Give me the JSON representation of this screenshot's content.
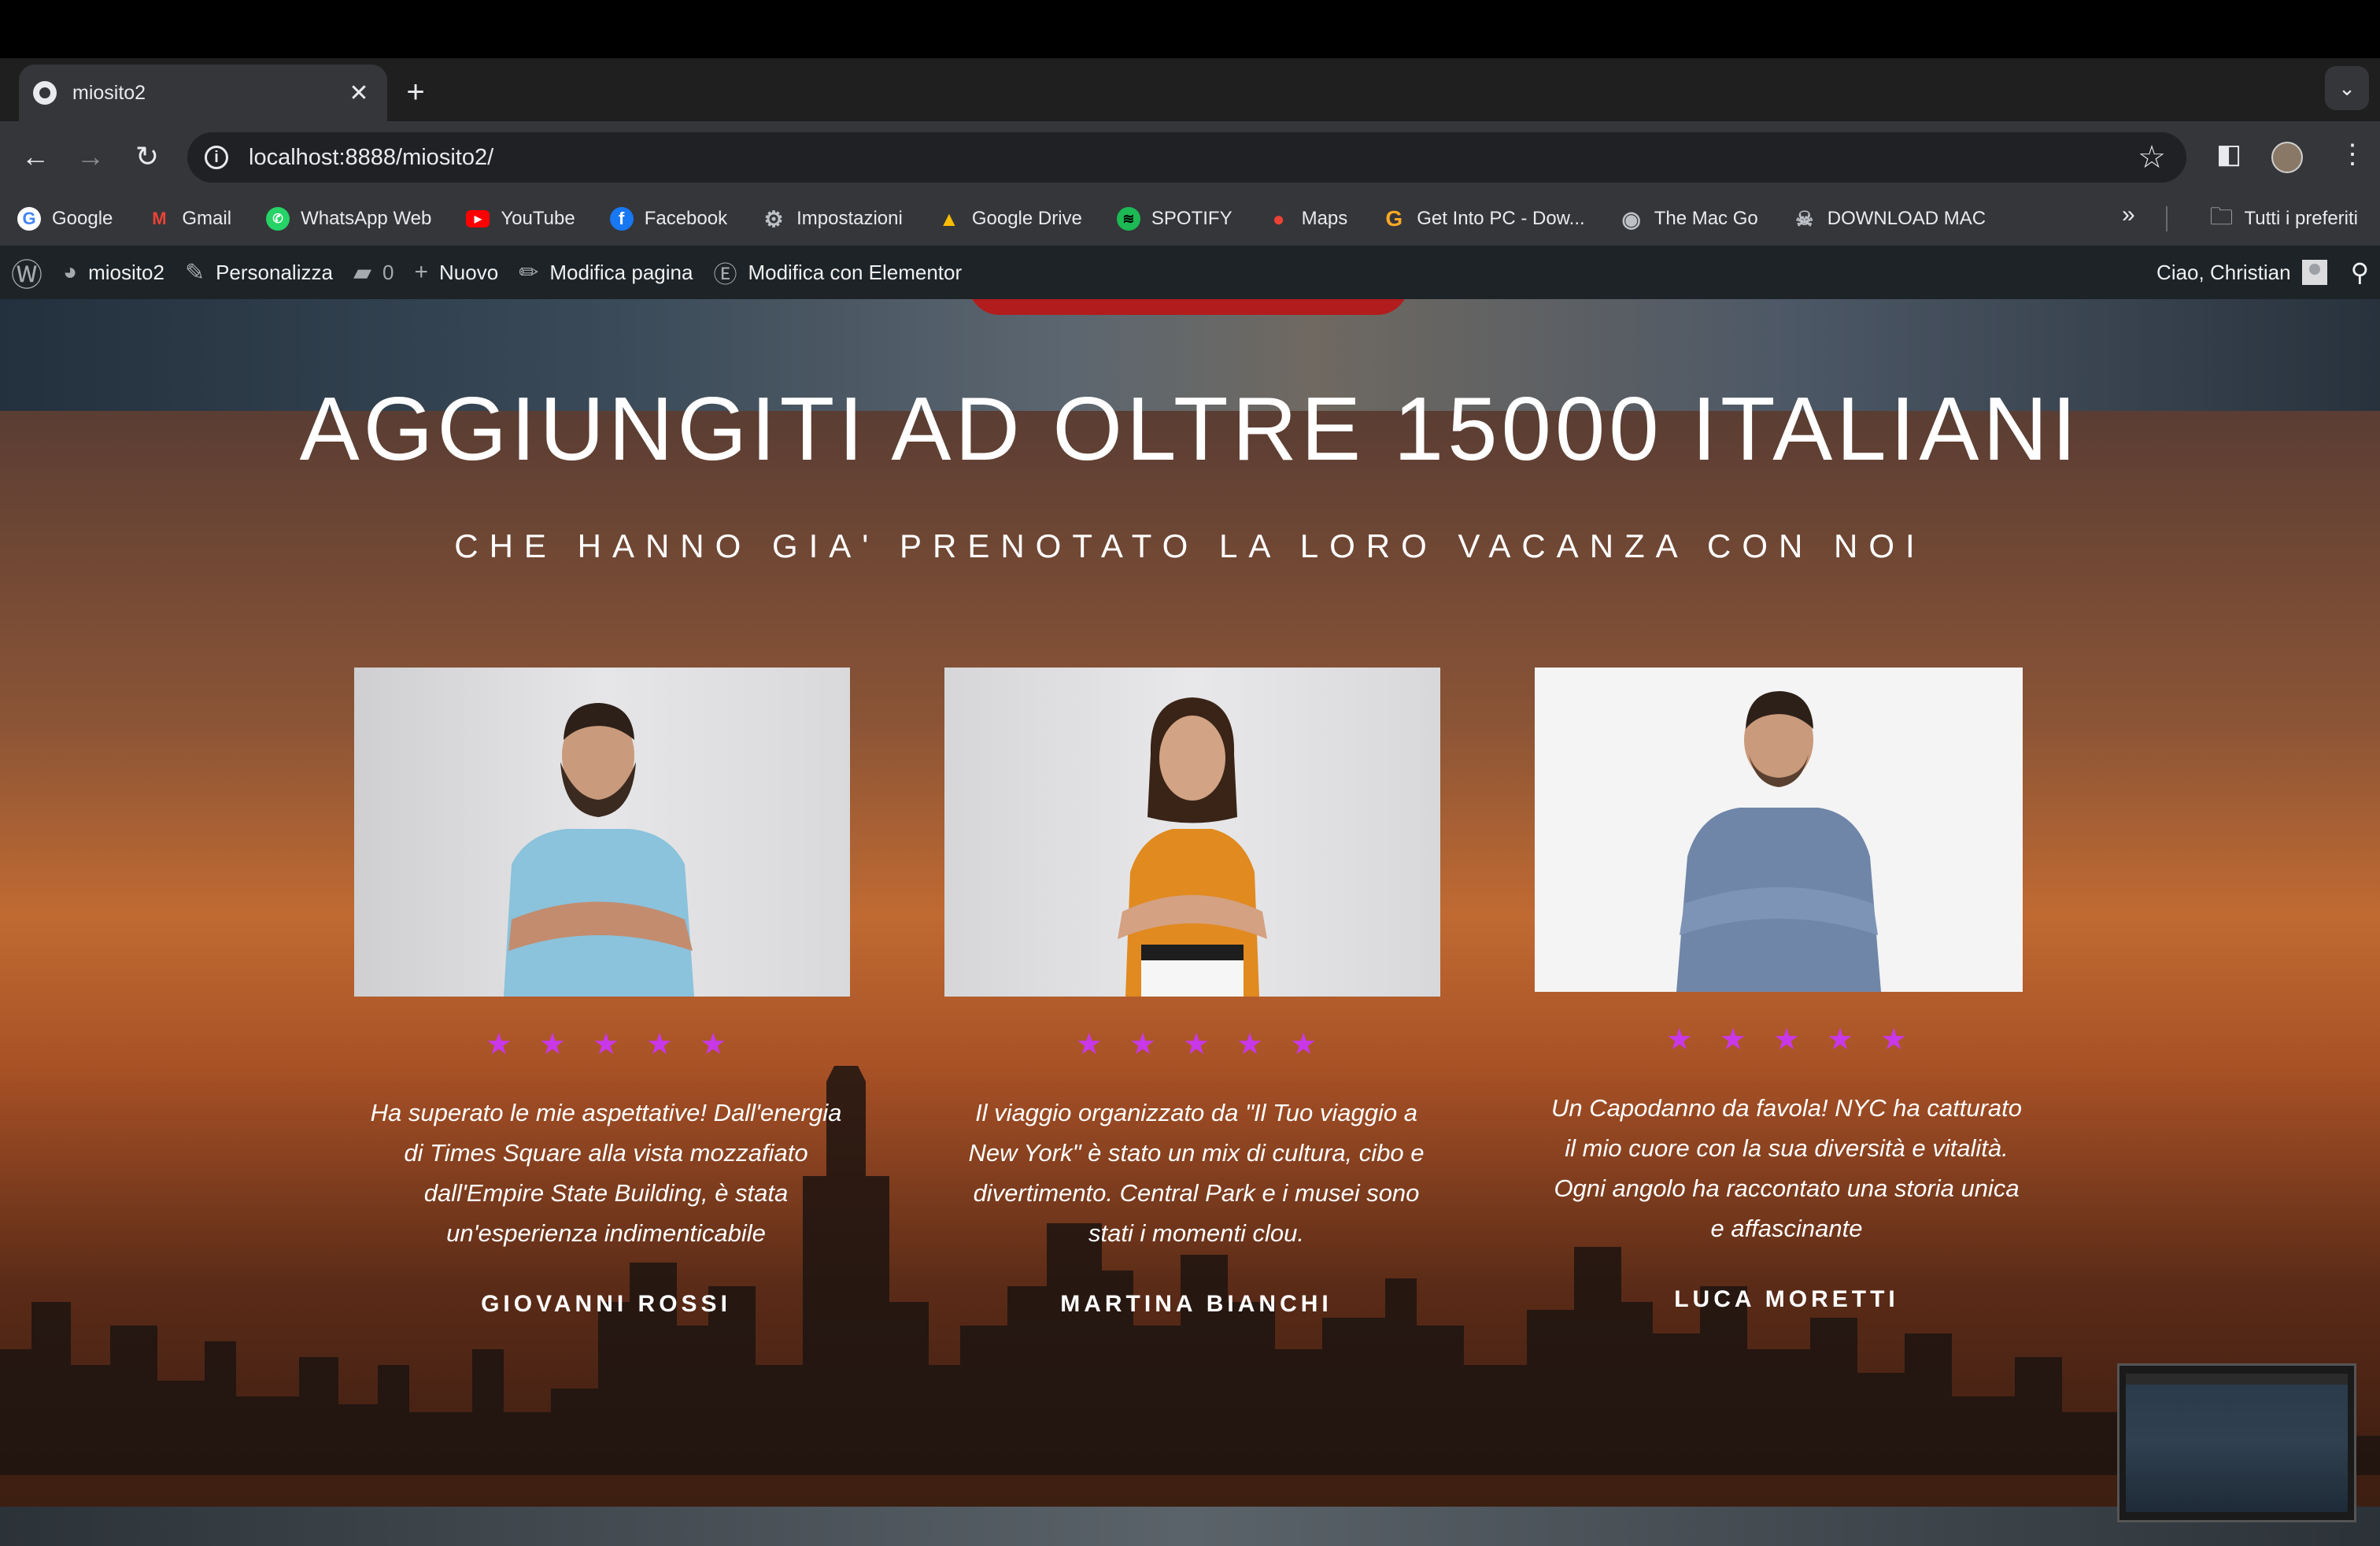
{
  "browser": {
    "tab_title": "miosito2",
    "url": "localhost:8888/miosito2/",
    "bookmarks": [
      {
        "label": "Google",
        "icon": "google-icon"
      },
      {
        "label": "Gmail",
        "icon": "gmail-icon"
      },
      {
        "label": "WhatsApp Web",
        "icon": "whatsapp-icon"
      },
      {
        "label": "YouTube",
        "icon": "youtube-icon"
      },
      {
        "label": "Facebook",
        "icon": "facebook-icon"
      },
      {
        "label": "Impostazioni",
        "icon": "gear-icon"
      },
      {
        "label": "Google Drive",
        "icon": "google-drive-icon"
      },
      {
        "label": "SPOTIFY",
        "icon": "spotify-icon"
      },
      {
        "label": "Maps",
        "icon": "maps-icon"
      },
      {
        "label": "Get Into PC - Dow...",
        "icon": "getintopc-icon"
      },
      {
        "label": "The Mac Go",
        "icon": "globe-icon"
      },
      {
        "label": "DOWNLOAD MAC",
        "icon": "skull-icon"
      }
    ],
    "all_bookmarks_label": "Tutti i preferiti"
  },
  "wp_admin_bar": {
    "site_name": "miosito2",
    "customize": "Personalizza",
    "comments_count": "0",
    "new": "Nuovo",
    "edit_page": "Modifica pagina",
    "edit_elementor": "Modifica con Elementor",
    "greeting": "Ciao, Christian"
  },
  "section": {
    "title": "AGGIUNGITI AD OLTRE 15000 ITALIANI",
    "subtitle": "CHE HANNO GIA' PRENOTATO LA LORO VACANZA CON NOI"
  },
  "testimonials": [
    {
      "rating": 5,
      "quote": "Ha superato le mie aspettative! Dall'energia di Times Square alla vista mozzafiato dall'Empire State Building, è stata un'esperienza indimenticabile",
      "name": "GIOVANNI ROSSI"
    },
    {
      "rating": 5,
      "quote": "Il viaggio organizzato da \"Il Tuo viaggio a New York\" è stato un mix di cultura, cibo e divertimento. Central Park e i musei sono stati i momenti clou.",
      "name": "MARTINA BIANCHI"
    },
    {
      "rating": 5,
      "quote": "Un Capodanno da favola! NYC ha catturato il mio cuore con la sua diversità e vitalità. Ogni angolo ha raccontato una storia unica e affascinante",
      "name": "LUCA MORETTI"
    }
  ],
  "colors": {
    "star": "#c838e8",
    "wp_bar": "#1d2327",
    "chrome_toolbar": "#35363a"
  }
}
